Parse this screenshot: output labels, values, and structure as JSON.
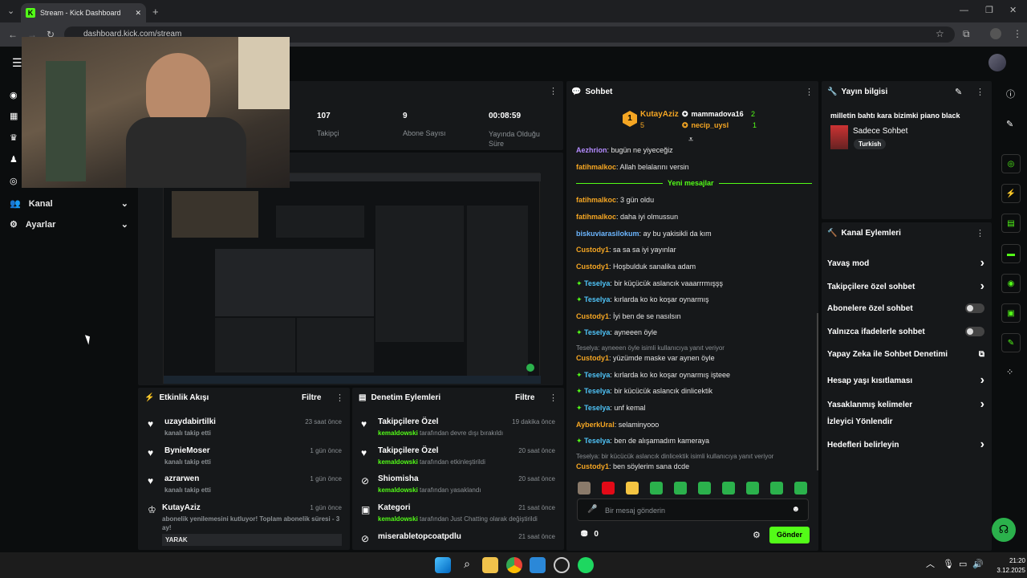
{
  "browser": {
    "tab_title": "Stream - Kick Dashboard",
    "url": "dashboard.kick.com/stream"
  },
  "stats": {
    "followers_value": "107",
    "followers_label": "Takipçi",
    "subs_value": "9",
    "subs_label": "Abone Sayısı",
    "uptime_value": "00:08:59",
    "uptime_label": "Yayında Olduğu Süre"
  },
  "leftnav": {
    "channel": "Kanal",
    "settings": "Ayarlar"
  },
  "chat": {
    "title": "Sohbet",
    "top": [
      {
        "rank": "1",
        "name": "KutayAziz",
        "count": "5"
      },
      {
        "name": "mammadova16",
        "count": "2"
      },
      {
        "name": "necip_uysl",
        "count": "1"
      }
    ],
    "new_messages": "Yeni mesajlar",
    "messages": [
      {
        "user": "Aezhrion",
        "text": "bugün ne yiyeceğiz",
        "c": "u-pu"
      },
      {
        "user": "fatihmalkoc",
        "text": "Allah belalarını versin",
        "c": "u-or"
      },
      {
        "user": "fatihmalkoc",
        "text": "3 gün oldu",
        "c": "u-or"
      },
      {
        "user": "fatihmalkoc",
        "text": "daha iyi olmussun",
        "c": "u-or"
      },
      {
        "user": "biskuviarasilokum",
        "text": "ay bu yakisikli da kım",
        "c": "u-bl"
      },
      {
        "user": "Custody1",
        "text": "sa sa sa iyi yayınlar",
        "c": "u-or"
      },
      {
        "user": "Custody1",
        "text": "Hoşbulduk sanalika adam",
        "c": "u-or"
      },
      {
        "user": "Teselya",
        "text": "bir küçücük aslancık vaaarrrmışşş",
        "c": "u-gr"
      },
      {
        "user": "Teselya",
        "text": "kırlarda ko ko koşar oynarmış",
        "c": "u-gr"
      },
      {
        "user": "Custody1",
        "text": "İyi ben de se nasılsın",
        "c": "u-or"
      },
      {
        "user": "Teselya",
        "text": "ayneeen öyle",
        "c": "u-gr"
      }
    ],
    "reply1": "Teselya: ayneeen öyle isimli kullanıcıya yanıt veriyor",
    "messages2": [
      {
        "user": "Custody1",
        "text": "yüzümde maske var aynen öyle",
        "c": "u-or"
      },
      {
        "user": "Teselya",
        "text": "kırlarda ko ko koşar oynarmış işteee",
        "c": "u-gr"
      },
      {
        "user": "Teselya",
        "text": "bir kücücük aslancık dinlicektik",
        "c": "u-gr"
      },
      {
        "user": "Teselya",
        "text": "unf kemal",
        "c": "u-gr"
      },
      {
        "user": "AyberkUral",
        "text": "selaminyooo",
        "c": "u-or"
      },
      {
        "user": "Teselya",
        "text": "ben de alışamadım kameraya",
        "c": "u-gr"
      }
    ],
    "reply2": "Teselya: bir kücücük aslancık dinlicektik isimli kullanıcıya yanıt veriyor",
    "last": {
      "user": "Custody1",
      "text": "ben söylerim sana dcde"
    },
    "input_placeholder": "Bir mesaj gönderin",
    "points": "0",
    "send": "Gönder"
  },
  "info": {
    "title": "Yayın bilgisi",
    "stream_title": "milletin bahtı kara bizimki piano black",
    "category": "Sadece Sohbet",
    "tag": "Turkish"
  },
  "actions": {
    "title": "Kanal Eylemleri",
    "items": [
      {
        "label": "Yavaş mod",
        "kind": "chevron"
      },
      {
        "label": "Takipçilere özel sohbet",
        "kind": "chevron"
      },
      {
        "label": "Abonelere özel sohbet",
        "kind": "toggle"
      },
      {
        "label": "Yalnızca ifadelerle sohbet",
        "kind": "toggle"
      },
      {
        "label": "Yapay Zeka ile Sohbet Denetimi",
        "kind": "ext"
      },
      {
        "label": "Hesap yaşı kısıtlaması",
        "kind": "chevron"
      },
      {
        "label": "Yasaklanmış kelimeler",
        "kind": "chevron"
      },
      {
        "label": "İzleyici Yönlendir",
        "kind": "none"
      },
      {
        "label": "Hedefleri belirleyin",
        "kind": "chevron"
      }
    ]
  },
  "activity": {
    "title": "Etkinlik Akışı",
    "filter": "Filtre",
    "items": [
      {
        "name": "uzaydabirtilki",
        "sub": "kanalı takip etti",
        "time": "23 saat önce"
      },
      {
        "name": "BynieMoser",
        "sub": "kanalı takip etti",
        "time": "1 gün önce"
      },
      {
        "name": "azrarwen",
        "sub": "kanalı takip etti",
        "time": "1 gün önce"
      },
      {
        "name": "KutayAziz",
        "sub": "abonelik yenilemesini kutluyor! Toplam abonelik süresi - 3 ay!",
        "time": "1 gün önce"
      }
    ],
    "badge": "YARAK"
  },
  "moderation": {
    "title": "Denetim Eylemleri",
    "filter": "Filtre",
    "items": [
      {
        "name": "Takipçilere Özel",
        "mod": "kemaldowski",
        "rest": "tarafından devre dışı bırakıldı",
        "time": "19 dakika önce"
      },
      {
        "name": "Takipçilere Özel",
        "mod": "kemaldowski",
        "rest": "tarafından etkinleştirildi",
        "time": "20 saat önce"
      },
      {
        "name": "Shiomisha",
        "mod": "kemaldowski",
        "rest": "tarafından yasaklandı",
        "time": "20 saat önce"
      },
      {
        "name": "Kategori",
        "mod": "kemaldowski",
        "rest": "tarafından Just Chatting olarak değiştirildi",
        "time": "21 saat önce"
      },
      {
        "name": "miserabletopcoatpdlu",
        "mod": "",
        "rest": "",
        "time": "21 saat önce"
      }
    ]
  },
  "taskbar": {
    "time": "21:20",
    "date": "3.12.2025"
  },
  "colors": {
    "accent": "#53fc18",
    "panel": "#16181a",
    "bg": "#0b0d0e"
  }
}
